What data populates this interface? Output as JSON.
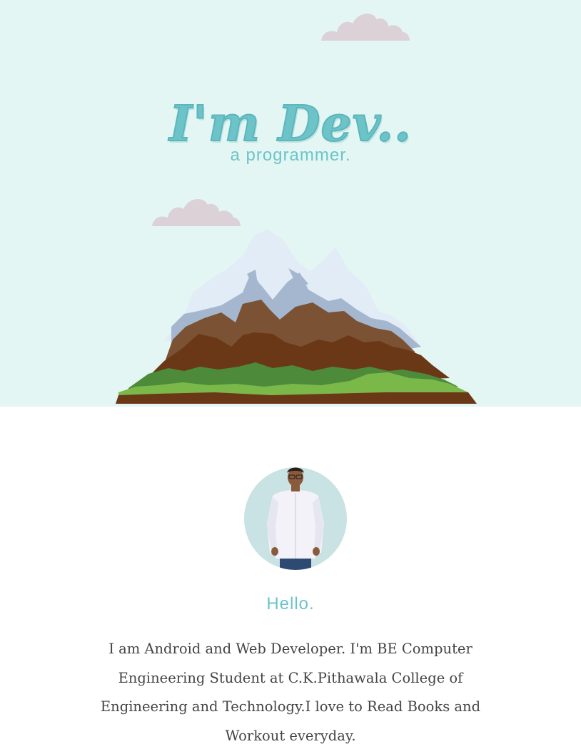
{
  "hero": {
    "title": "I'm Dev..",
    "subtitle": "a programmer."
  },
  "about": {
    "greeting": "Hello.",
    "bio": "I am Android and Web Developer. I'm BE Computer Engineering Student at C.K.Pithawala College of Engineering and Technology.I love to Read Books and Workout everyday."
  },
  "colors": {
    "hero_background": "#e3f6f3",
    "accent": "#6cc4c9",
    "cloud": "#dbd1d7",
    "text": "#444444"
  }
}
